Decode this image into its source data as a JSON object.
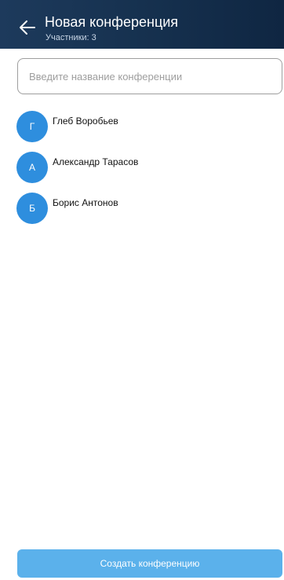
{
  "header": {
    "title": "Новая конференция",
    "subtitle": "Участники: 3"
  },
  "conference_name": {
    "value": "",
    "placeholder": "Введите название конференции"
  },
  "participants": [
    {
      "initial": "Г",
      "name": "Глеб Воробьев"
    },
    {
      "initial": "А",
      "name": "Александр Тарасов"
    },
    {
      "initial": "Б",
      "name": "Борис Антонов"
    }
  ],
  "create_button_label": "Создать конференцию",
  "colors": {
    "header_bg": "#16314f",
    "avatar_bg": "#2e8ede",
    "button_bg": "#5bb1eb"
  },
  "icons": {
    "back": "arrow-left-icon"
  }
}
